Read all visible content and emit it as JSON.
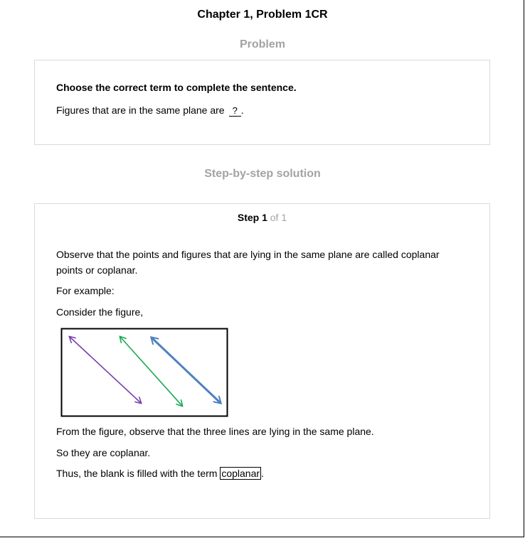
{
  "header": {
    "title": "Chapter 1, Problem 1CR"
  },
  "problem": {
    "heading": "Problem",
    "instruction": "Choose the correct term to complete the sentence.",
    "sentence": "Figures that are in the same plane are",
    "blank": "?",
    "end_punct": "."
  },
  "solution": {
    "heading": "Step-by-step solution",
    "step_prefix": "Step 1",
    "step_suffix": "of 1",
    "paragraph1_line1": "Observe that the points and figures that are lying in the same plane are called coplanar",
    "paragraph1_line2": "points or coplanar.",
    "example": "For example:",
    "consider": "Consider the figure,",
    "figure": {
      "line_colors": [
        "#7a3fb0",
        "#1aaa55",
        "#4f81bd"
      ]
    },
    "observation": "From the figure, observe that the three lines are lying in the same plane.",
    "conclusion": "So they are coplanar.",
    "final_prefix": "Thus, the blank is filled with the term",
    "answer": "coplanar",
    "final_suffix": "."
  }
}
